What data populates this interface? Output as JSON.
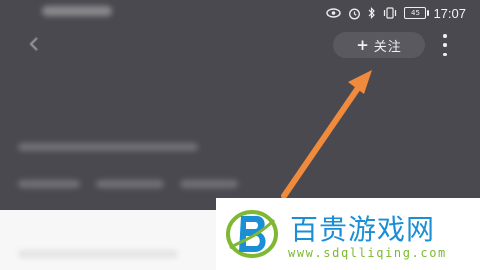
{
  "status_bar": {
    "time": "17:07",
    "battery_level": "45",
    "icons": [
      "eye-icon",
      "alarm-icon",
      "bluetooth-icon",
      "vibrate-icon",
      "battery-icon"
    ]
  },
  "header": {
    "follow_button": {
      "plus": "+",
      "label": "关注"
    }
  },
  "watermark": {
    "title": "百贵游戏网",
    "url": "www.sdqlliqing.com"
  },
  "colors": {
    "overlay": "#4a4950",
    "arrow": "#f08a3c",
    "watermark_title": "#1a8fd6",
    "watermark_url": "#7fb833"
  }
}
